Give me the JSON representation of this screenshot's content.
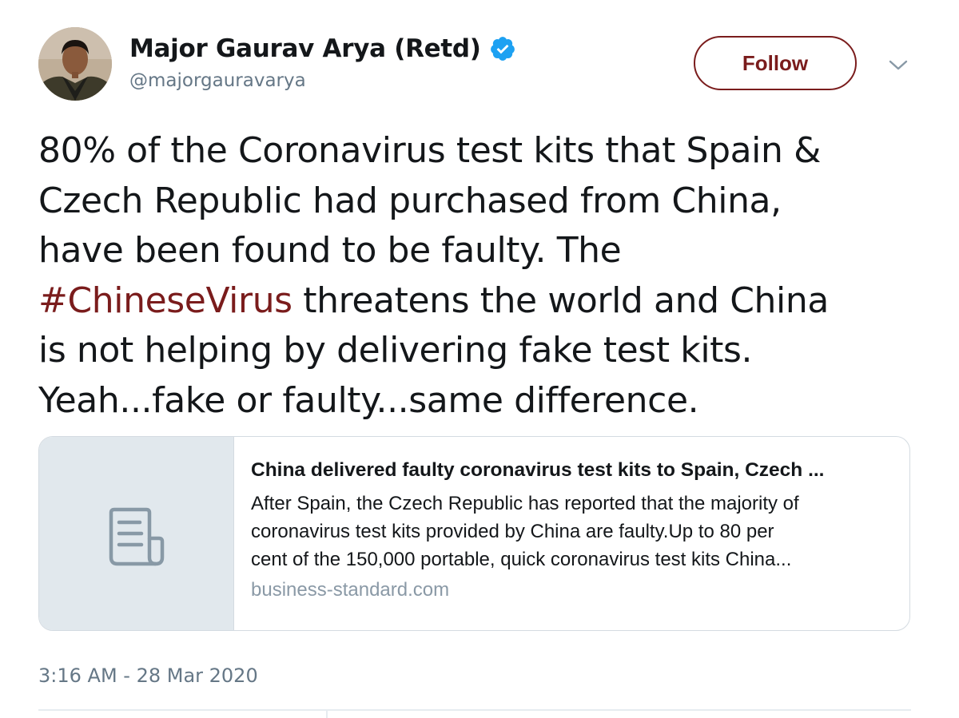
{
  "author": {
    "display_name": "Major Gaurav Arya (Retd)",
    "handle": "@majorgauravarya",
    "verified": true,
    "avatar_icon": "person-photo"
  },
  "actions": {
    "follow_label": "Follow",
    "menu_icon": "chevron-down-icon"
  },
  "tweet": {
    "lines": [
      "80% of the Coronavirus test kits that Spain &",
      "Czech Republic had purchased from China,",
      "have been found to be faulty. The",
      "",
      "is not helping by delivering fake test kits.",
      "Yeah...fake or faulty...same difference."
    ],
    "hashtag": "#ChineseVirus",
    "line4_rest": " threatens the world and China",
    "timestamp": "3:16 AM - 28 Mar 2020"
  },
  "link_card": {
    "thumbnail_icon": "document-icon",
    "title": "China delivered faulty coronavirus test kits to Spain, Czech ...",
    "description_lines": [
      "After Spain, the Czech Republic has reported that the majority of",
      "coronavirus test kits provided by China are faulty.Up to 80 per",
      "cent of the 150,000 portable, quick coronavirus test kits China..."
    ],
    "domain": "business-standard.com"
  },
  "colors": {
    "accent": "#7a1c1c",
    "verified": "#1da1f2",
    "secondary_text": "#657786",
    "card_thumb_bg": "#e1e8ed"
  }
}
